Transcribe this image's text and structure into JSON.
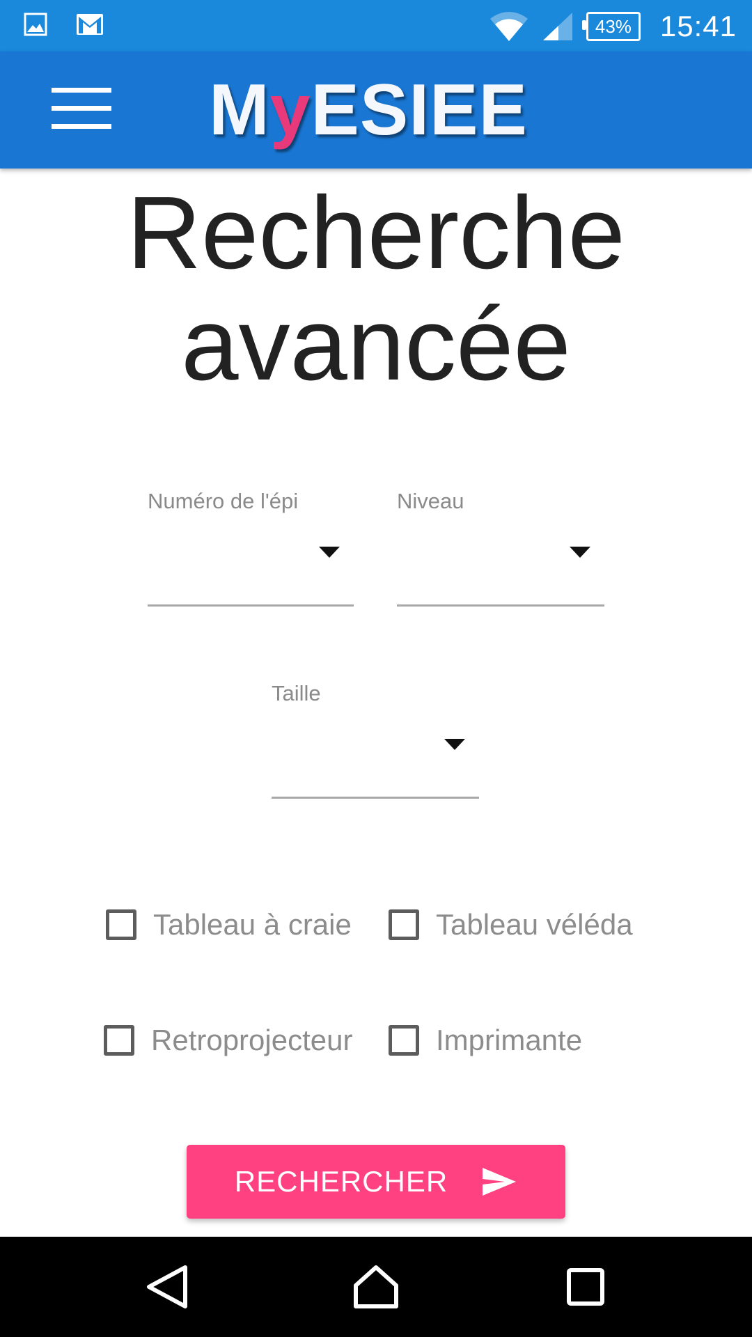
{
  "status_bar": {
    "time": "15:41",
    "battery": "43%",
    "icons": [
      "image-notification-icon",
      "gmail-notification-icon",
      "wifi-icon",
      "signal-icon",
      "battery-icon"
    ]
  },
  "app_bar": {
    "logo_prefix": "M",
    "logo_accent": "y",
    "logo_suffix": "ESIEE",
    "menu_icon": "hamburger-menu-icon"
  },
  "page": {
    "title_line1": "Recherche",
    "title_line2": "avancée"
  },
  "filters": {
    "epi_label": "Numéro de l'épi",
    "epi_value": "",
    "niveau_label": "Niveau",
    "niveau_value": "",
    "taille_label": "Taille",
    "taille_value": ""
  },
  "options": [
    {
      "label": "Tableau à craie",
      "checked": false
    },
    {
      "label": "Tableau véléda",
      "checked": false
    },
    {
      "label": "Retroprojecteur",
      "checked": false
    },
    {
      "label": "Imprimante",
      "checked": false
    }
  ],
  "search_button": {
    "label": "RECHERCHER",
    "icon": "send-icon"
  },
  "colors": {
    "status_bar": "#1a88db",
    "app_bar": "#1976d2",
    "accent": "#ff4081",
    "logo_accent": "#e8397a"
  },
  "nav_bar": {
    "buttons": [
      "back-icon",
      "home-icon",
      "recents-icon"
    ]
  }
}
